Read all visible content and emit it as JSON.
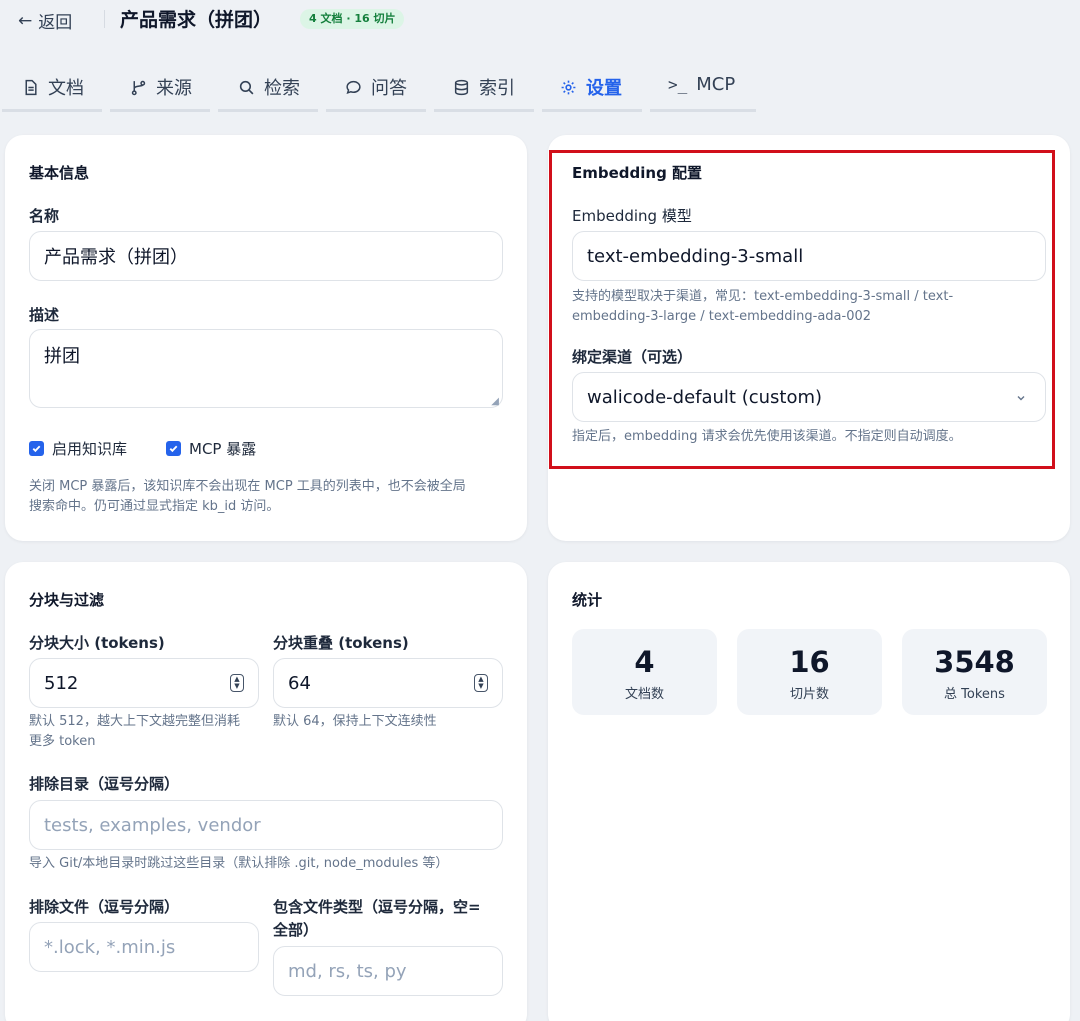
{
  "header": {
    "back_label": "返回",
    "title": "产品需求（拼团）",
    "badge": "4 文档 · 16 切片"
  },
  "tabs": [
    {
      "label": "文档",
      "icon": "document-icon"
    },
    {
      "label": "来源",
      "icon": "git-branch-icon"
    },
    {
      "label": "检索",
      "icon": "search-icon"
    },
    {
      "label": "问答",
      "icon": "chat-bubble-icon"
    },
    {
      "label": "索引",
      "icon": "database-icon"
    },
    {
      "label": "设置",
      "icon": "gear-icon",
      "active": true
    },
    {
      "label": "MCP",
      "icon": "terminal-icon"
    }
  ],
  "basic": {
    "title": "基本信息",
    "name_label": "名称",
    "name_value": "产品需求（拼团）",
    "desc_label": "描述",
    "desc_value": "拼团",
    "enable_kb_label": "启用知识库",
    "mcp_expose_label": "MCP 暴露",
    "hint_line1": "关闭 MCP 暴露后，该知识库不会出现在 MCP 工具的列表中，也不会被全局",
    "hint_line2": "搜索命中。仍可通过显式指定 kb_id 访问。"
  },
  "embedding": {
    "title": "Embedding 配置",
    "model_label": "Embedding 模型",
    "model_value": "text-embedding-3-small",
    "model_hint_line1": "支持的模型取决于渠道，常见：text-embedding-3-small / text-",
    "model_hint_line2": "embedding-3-large / text-embedding-ada-002",
    "channel_label": "绑定渠道（可选）",
    "channel_value": "walicode-default (custom)",
    "channel_hint": "指定后，embedding 请求会优先使用该渠道。不指定则自动调度。"
  },
  "chunking": {
    "title": "分块与过滤",
    "size_label": "分块大小 (tokens)",
    "size_value": "512",
    "size_hint_line1": "默认 512，越大上下文越完整但消耗",
    "size_hint_line2": "更多 token",
    "overlap_label": "分块重叠 (tokens)",
    "overlap_value": "64",
    "overlap_hint": "默认 64，保持上下文连续性",
    "exclude_dirs_label": "排除目录（逗号分隔）",
    "exclude_dirs_placeholder": "tests, examples, vendor",
    "exclude_dirs_hint": "导入 Git/本地目录时跳过这些目录（默认排除 .git, node_modules 等）",
    "exclude_files_label": "排除文件（逗号分隔）",
    "exclude_files_placeholder": "*.lock, *.min.js",
    "include_types_label_line1": "包含文件类型（逗号分隔，空=",
    "include_types_label_line2": "全部）",
    "include_types_placeholder": "md, rs, ts, py"
  },
  "stats": {
    "title": "统计",
    "items": [
      {
        "value": "4",
        "label": "文档数"
      },
      {
        "value": "16",
        "label": "切片数"
      },
      {
        "value": "3548",
        "label": "总 Tokens"
      }
    ]
  },
  "colors": {
    "accent": "#2563eb",
    "highlight_border": "#d10f1a",
    "badge_bg": "#dcf5e6",
    "badge_text": "#15803d"
  }
}
